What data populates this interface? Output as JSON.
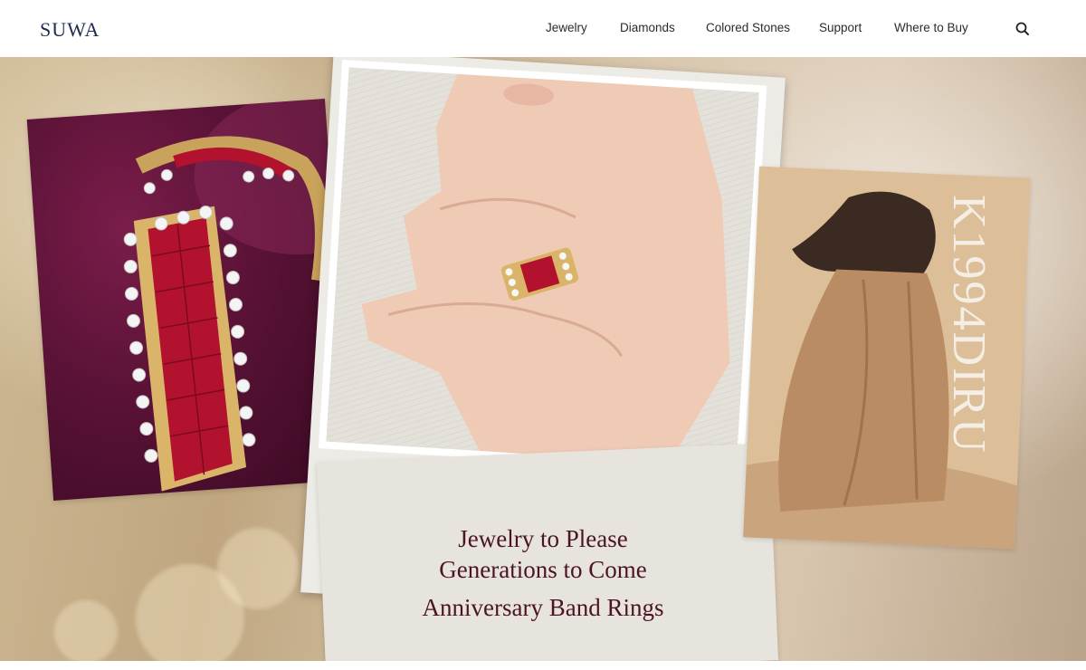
{
  "brand": {
    "logo_text": "SUWA"
  },
  "nav": {
    "items": [
      {
        "label": "Jewelry"
      },
      {
        "label": "Diamonds"
      },
      {
        "label": "Colored Stones"
      },
      {
        "label": "Support"
      },
      {
        "label": "Where to Buy"
      }
    ],
    "search_icon": "search-icon"
  },
  "hero": {
    "caption_line1": "Jewelry to Please",
    "caption_line2": "Generations to Come",
    "caption_sub": "Anniversary Band Rings",
    "product_code": "K1994DIRU"
  },
  "colors": {
    "brand_navy": "#1f2a4f",
    "caption_burgundy": "#4b1424",
    "ruby": "#b3122e",
    "gold": "#d9b469"
  }
}
